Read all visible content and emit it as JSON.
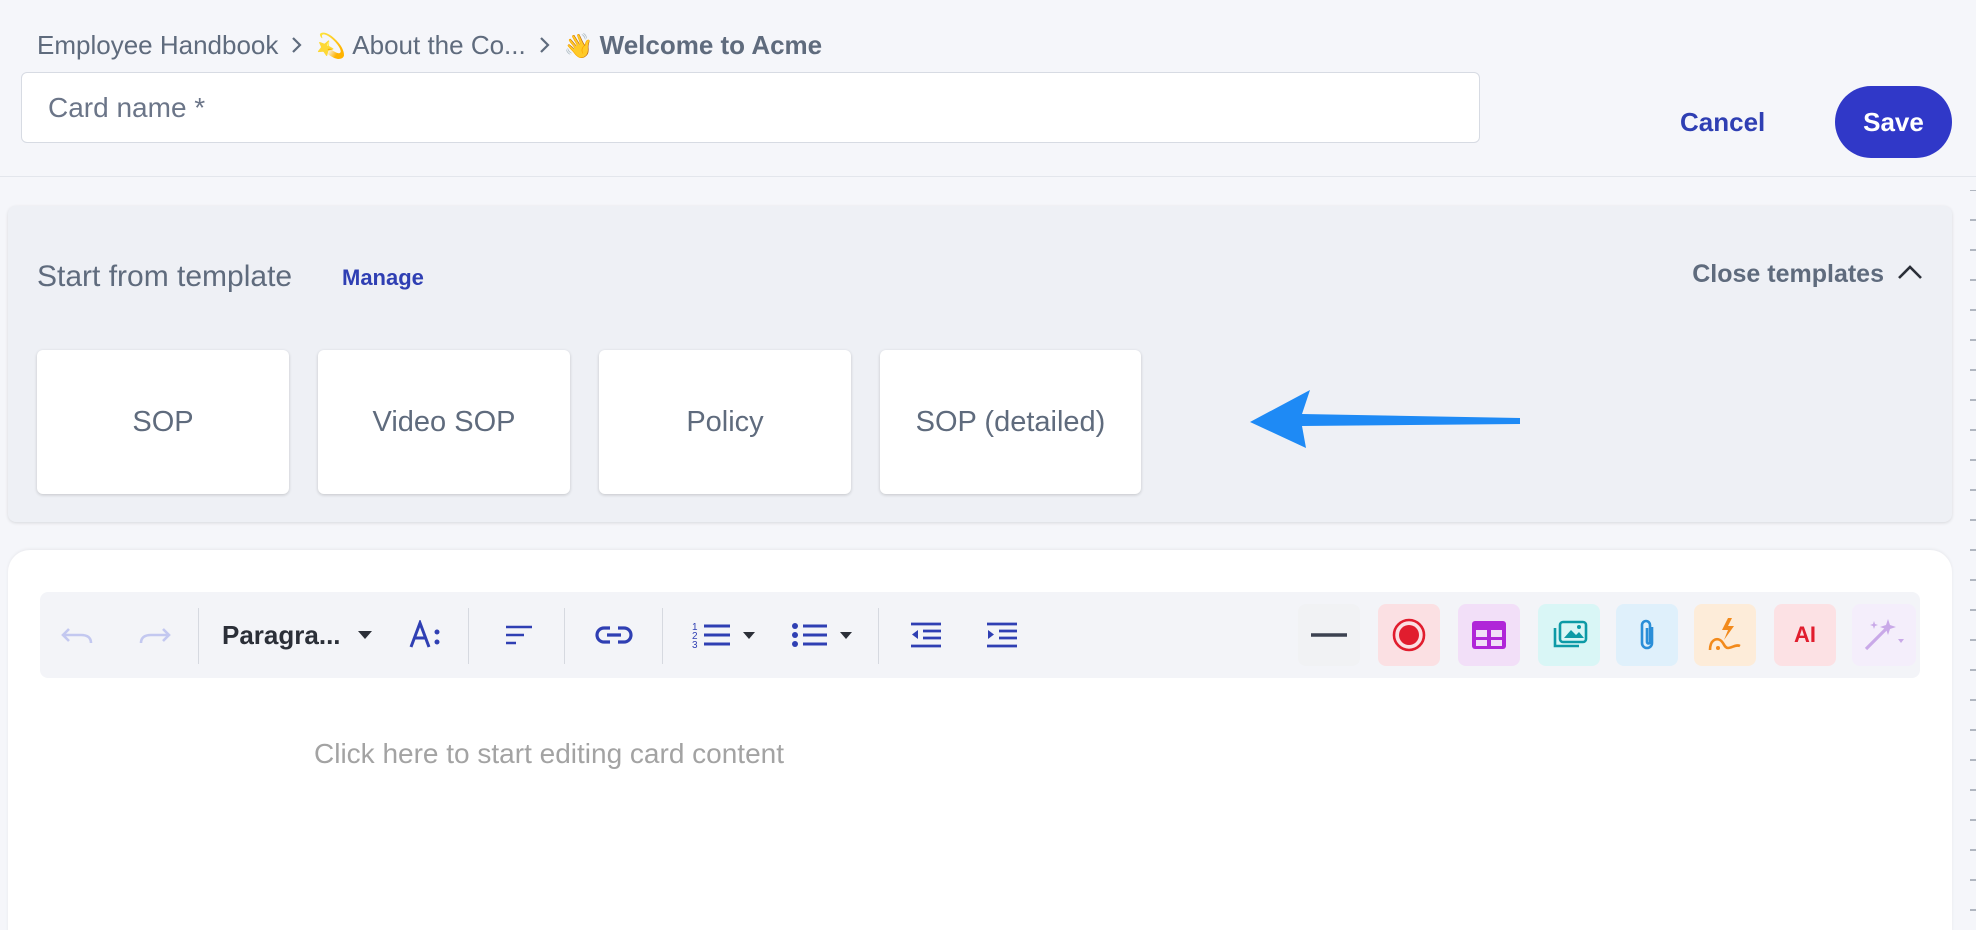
{
  "breadcrumb": {
    "items": [
      {
        "label": "Employee Handbook",
        "emoji": ""
      },
      {
        "label": "About the Co...",
        "emoji": "💫"
      },
      {
        "label": "Welcome to Acme",
        "emoji": "👋"
      }
    ]
  },
  "card_name": {
    "placeholder": "Card name *",
    "value": ""
  },
  "actions": {
    "cancel_label": "Cancel",
    "save_label": "Save"
  },
  "templates": {
    "title": "Start from template",
    "manage_label": "Manage",
    "close_label": "Close templates",
    "items": [
      "SOP",
      "Video SOP",
      "Policy",
      "SOP (detailed)"
    ]
  },
  "toolbar": {
    "paragraph_label": "Paragra...",
    "icons": [
      "undo-icon",
      "redo-icon",
      "paragraph-style-dropdown",
      "font-size-icon",
      "align-icon",
      "link-icon",
      "ordered-list-icon",
      "bullet-list-icon",
      "outdent-icon",
      "indent-icon",
      "horizontal-rule-icon",
      "record-icon",
      "table-icon",
      "image-gallery-icon",
      "attachment-icon",
      "quick-action-icon",
      "ai-icon",
      "magic-wand-icon"
    ],
    "ai_label": "AI"
  },
  "editor": {
    "placeholder": "Click here to start editing card content"
  },
  "colors": {
    "accent": "#3038c8",
    "link": "#2f3fb3",
    "arrow": "#1e8af5"
  }
}
